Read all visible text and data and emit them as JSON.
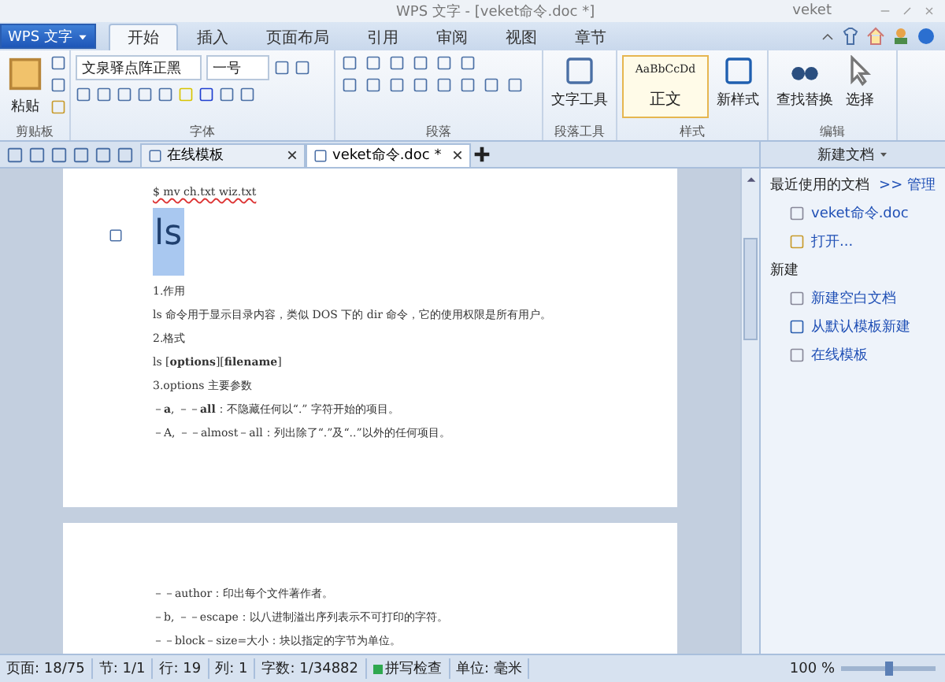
{
  "title_bar": {
    "app_title": "WPS 文字 - [veket命令.doc *]",
    "window_name": "veket"
  },
  "app_menu": {
    "label": "WPS 文字"
  },
  "ribbon_tabs": [
    {
      "label": "开始",
      "selected": true
    },
    {
      "label": "插入",
      "selected": false
    },
    {
      "label": "页面布局",
      "selected": false
    },
    {
      "label": "引用",
      "selected": false
    },
    {
      "label": "审阅",
      "selected": false
    },
    {
      "label": "视图",
      "selected": false
    },
    {
      "label": "章节",
      "selected": false
    }
  ],
  "ribbon": {
    "clipboard": {
      "paste": "粘贴",
      "group": "剪贴板"
    },
    "font": {
      "name": "文泉驿点阵正黑",
      "size": "一号",
      "group": "字体"
    },
    "paragraph": {
      "group": "段落"
    },
    "paragraph_tools": {
      "button": "文字工具",
      "group": "段落工具"
    },
    "styles": {
      "preview": "AaBbCcDd",
      "style_name": "正文",
      "new_style": "新样式",
      "group": "样式"
    },
    "editing": {
      "find_replace": "查找替换",
      "select": "选择",
      "group": "编辑"
    }
  },
  "doc_tabs": [
    {
      "label": "在线模板",
      "selected": false
    },
    {
      "label": "veket命令.doc *",
      "selected": true
    }
  ],
  "pages": [
    {
      "paragraphs": [
        {
          "kind": "command",
          "text": "$ mv ch.txt wiz.txt",
          "highlighted": false
        },
        {
          "kind": "heading",
          "text": "ls",
          "highlighted": true
        },
        {
          "kind": "body",
          "text": "1.作用",
          "highlighted": false
        },
        {
          "kind": "body",
          "text": "ls 命令用于显示目录内容，类似 DOS 下的 dir 命令，它的使用权限是所有用户。",
          "highlighted": false
        },
        {
          "kind": "body",
          "text": "2.格式",
          "highlighted": false
        },
        {
          "kind": "body",
          "text": "ls [**options**][**filename**]",
          "highlighted": false
        },
        {
          "kind": "body",
          "text": "3.options 主要参数",
          "highlighted": false
        },
        {
          "kind": "body",
          "text": "－**a**, －－**all**：不隐藏任何以“.” 字符开始的项目。",
          "highlighted": false
        },
        {
          "kind": "body",
          "text": "－A, －－almost－all：列出除了“.”及“..”以外的任何项目。",
          "highlighted": false
        }
      ]
    },
    {
      "paragraphs": [
        {
          "kind": "body",
          "text": "－－author：印出每个文件著作者。",
          "highlighted": false
        },
        {
          "kind": "body",
          "text": "－b, －－escape：以八进制溢出序列表示不可打印的字符。",
          "highlighted": false
        },
        {
          "kind": "body",
          "text": "－－block－size=大小：块以指定的字节为单位。",
          "highlighted": false
        }
      ]
    }
  ],
  "task_pane": {
    "title": "新建文档",
    "recent_heading": "最近使用的文档",
    "manage_link": ">> 管理",
    "recent": [
      {
        "kind": "file",
        "label": "veket命令.doc"
      },
      {
        "kind": "open",
        "label": "打开..."
      }
    ],
    "new_heading": "新建",
    "new_items": [
      {
        "kind": "blank",
        "label": "新建空白文档"
      },
      {
        "kind": "template",
        "label": "从默认模板新建"
      },
      {
        "kind": "online",
        "label": "在线模板"
      }
    ]
  },
  "status_bar": [
    {
      "kind": "text",
      "label": "页面: 18/75"
    },
    {
      "kind": "text",
      "label": "节: 1/1"
    },
    {
      "kind": "text",
      "label": "行: 19"
    },
    {
      "kind": "text",
      "label": "列: 1"
    },
    {
      "kind": "text",
      "label": "字数: 1/34882"
    },
    {
      "kind": "toggle",
      "label": "拼写检查"
    },
    {
      "kind": "text",
      "label": "单位: 毫米"
    }
  ],
  "zoom": {
    "label": "100 %",
    "level": 0.5
  }
}
